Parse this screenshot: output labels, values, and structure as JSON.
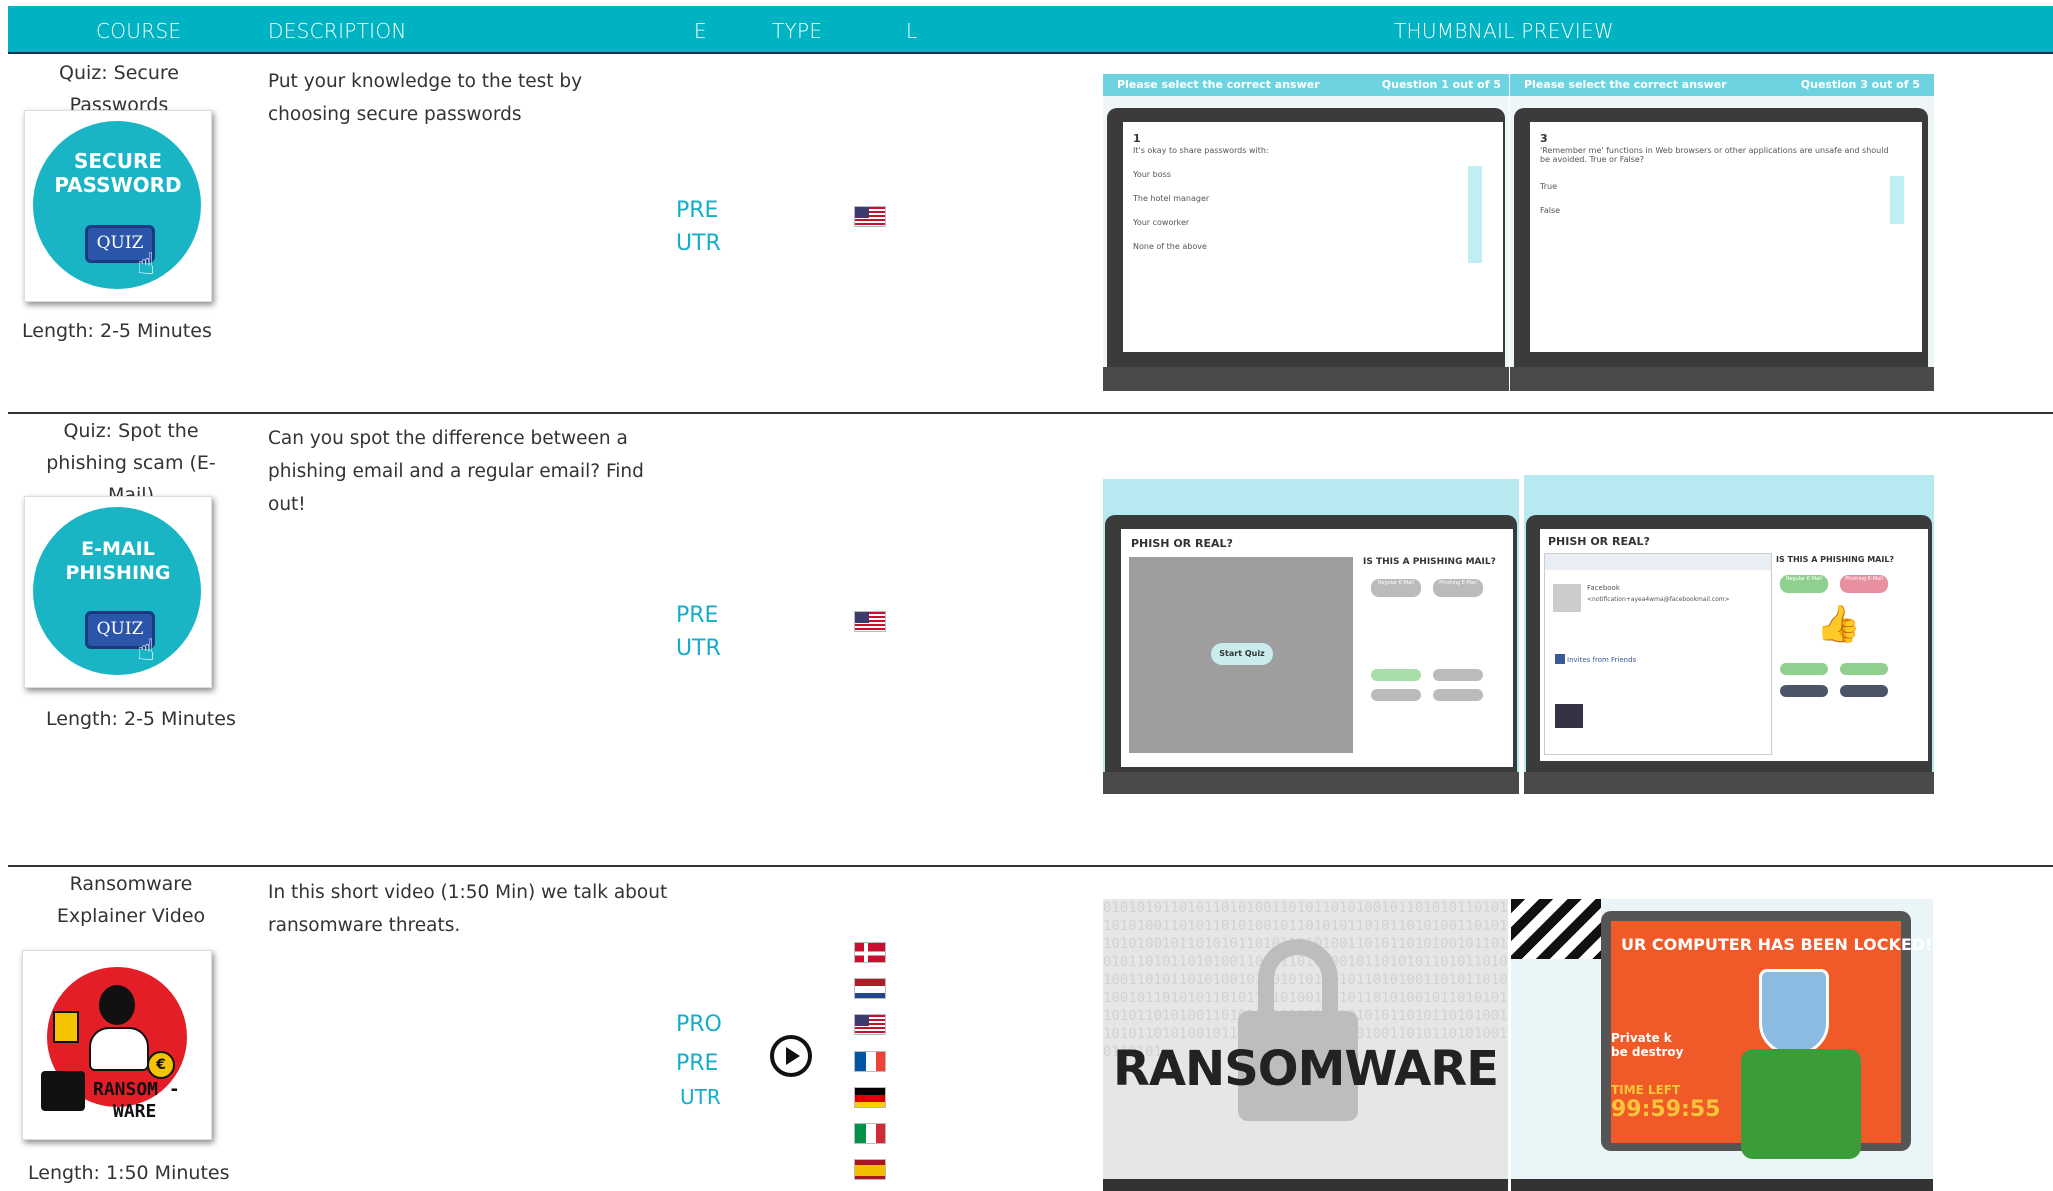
{
  "header": {
    "course": "COURSE",
    "description": "DESCRIPTION",
    "e": "E",
    "type": "TYPE",
    "l": "L",
    "thumbnail_preview": "THUMBNAIL PREVIEW"
  },
  "colors": {
    "header_bg": "#00b3c2",
    "accent": "#14aec8",
    "circle": "#19b5c5"
  },
  "courses": [
    {
      "title": "Quiz: Secure Passwords",
      "thumb_line1": "SECURE",
      "thumb_line2": "PASSWORD",
      "thumb_button": "QUIZ",
      "length": "Length: 2-5 Minutes",
      "description": "Put your knowledge to the test by choosing secure passwords",
      "e": [
        "PRE",
        "UTR"
      ],
      "flags": [
        "us"
      ],
      "preview": {
        "left": {
          "bar_left": "Please select the correct answer",
          "bar_right": "Question 1 out of 5",
          "number": "1",
          "question": "It's okay to share passwords with:",
          "options": [
            "Your boss",
            "The hotel manager",
            "Your coworker",
            "None of the above"
          ]
        },
        "right": {
          "bar_left": "Please select the correct answer",
          "bar_right": "Question 3 out of 5",
          "number": "3",
          "question": "'Remember me' functions in Web browsers or other applications are unsafe and should be avoided. True or False?",
          "options": [
            "True",
            "False"
          ]
        }
      }
    },
    {
      "title": "Quiz: Spot the phishing scam (E-Mail)",
      "thumb_line1": "E-MAIL",
      "thumb_line2": "PHISHING",
      "thumb_button": "QUIZ",
      "length": "Length: 2-5 Minutes",
      "description": "Can you spot the difference between a phishing email and a regular email? Find out!",
      "e": [
        "PRE",
        "UTR"
      ],
      "flags": [
        "us"
      ],
      "preview": {
        "left": {
          "heading": "PHISH OR REAL?",
          "side_heading": "IS THIS A PHISHING MAIL?",
          "start": "Start Quiz",
          "btn1": "Regular E-Mail",
          "btn2": "Phishing E-Mail"
        },
        "right": {
          "heading": "PHISH OR REAL?",
          "side_heading": "IS THIS A PHISHING MAIL?",
          "sender": "Facebook",
          "email": "<notification+ayea4wma@facebookmail.com>",
          "invite": "Invites from Friends",
          "btn1": "Regular E-Mail",
          "btn2": "Phishing E-Mail"
        }
      }
    },
    {
      "title": "Ransomware Explainer Video",
      "thumb_line1": "RANSOM -",
      "thumb_line2": "WARE",
      "length": "Length: 1:50 Minutes",
      "description": "In this short video (1:50 Min) we talk about ransomware threats.",
      "e": [
        "PRO",
        "PRE",
        "UTR"
      ],
      "type_icon": "play-icon",
      "flags": [
        "dk",
        "nl",
        "us",
        "fr",
        "de",
        "it",
        "es"
      ],
      "preview": {
        "left": {
          "word": "RANSOMWARE"
        },
        "right": {
          "headline": "UR COMPUTER HAS BEEN LOCKED!",
          "private": "Private k",
          "destroy": "be destroy",
          "time_left": "TIME LEFT",
          "timer": "99:59:55"
        }
      }
    }
  ]
}
